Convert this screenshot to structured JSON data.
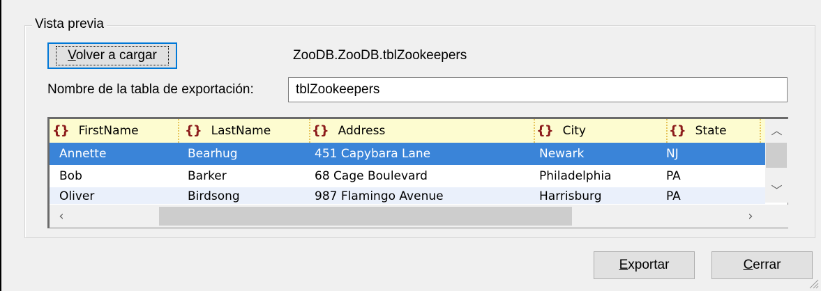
{
  "preview": {
    "group_title": "Vista previa",
    "reload_button": {
      "mnemonic": "V",
      "rest": "olver a cargar"
    },
    "table_path": "ZooDB.ZooDB.tblZookeepers",
    "export_name_label": "Nombre de la tabla de exportación:",
    "export_name_value": "tblZookeepers",
    "grid": {
      "column_icon": "brace-pair-icon",
      "columns": [
        "FirstName",
        "LastName",
        "Address",
        "City",
        "State"
      ],
      "rows": [
        [
          "Annette",
          "Bearhug",
          "451 Capybara Lane",
          "Newark",
          "NJ"
        ],
        [
          "Bob",
          "Barker",
          "68 Cage Boulevard",
          "Philadelphia",
          "PA"
        ],
        [
          "Oliver",
          "Birdsong",
          "987 Flamingo Avenue",
          "Harrisburg",
          "PA"
        ]
      ],
      "selected_row": 0
    }
  },
  "footer": {
    "export_button": {
      "mnemonic": "E",
      "rest": "xportar"
    },
    "close_button": {
      "mnemonic": "C",
      "rest": "errar"
    }
  },
  "colors": {
    "selection": "#3a84d8",
    "header_bg": "#fdfcd0",
    "icon": "#8b1a1a",
    "focus_border": "#0078d7"
  }
}
